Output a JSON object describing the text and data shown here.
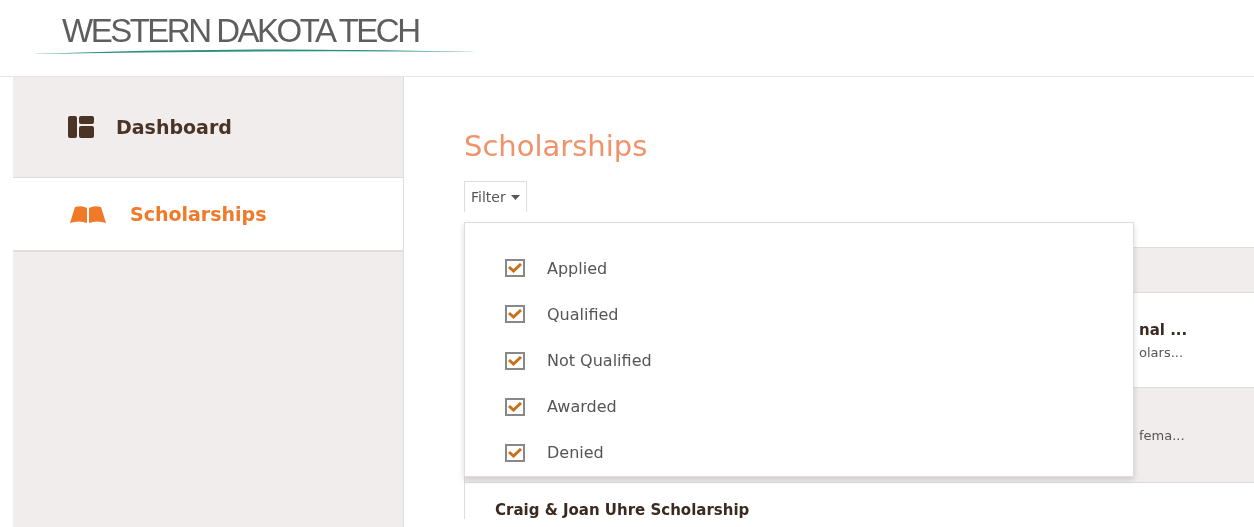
{
  "logo": {
    "text": "WESTERN DAKOTA TECH"
  },
  "sidebar": {
    "items": [
      {
        "label": "Dashboard",
        "kind": "dashboard",
        "selected": false
      },
      {
        "label": "Scholarships",
        "kind": "book",
        "selected": true
      }
    ]
  },
  "page_title": "Scholarships",
  "filter": {
    "label": "Filter",
    "expanded": true,
    "options": [
      {
        "label": "Applied",
        "checked": true
      },
      {
        "label": "Qualified",
        "checked": true
      },
      {
        "label": "Not Qualified",
        "checked": true
      },
      {
        "label": "Awarded",
        "checked": true
      },
      {
        "label": "Denied",
        "checked": true
      }
    ]
  },
  "list": {
    "rows": [
      {
        "title": "nal ...",
        "subtitle": "olars...",
        "shaded": false
      },
      {
        "subtitle": "fema...",
        "shaded": true
      },
      {
        "title": "Craig & Joan Uhre Scholarship",
        "shaded": false
      }
    ]
  }
}
